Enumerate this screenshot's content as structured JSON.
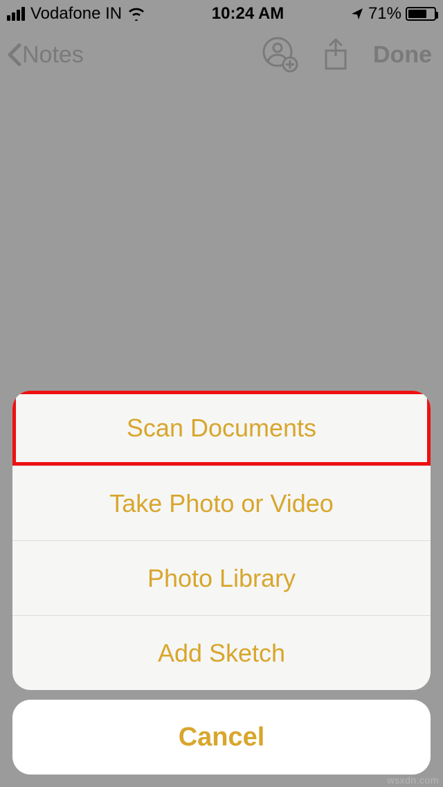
{
  "status": {
    "carrier": "Vodafone IN",
    "time": "10:24 AM",
    "battery_pct": "71%",
    "battery_fill_pct": 71
  },
  "nav": {
    "back_label": "Notes",
    "done_label": "Done"
  },
  "sheet": {
    "items": [
      {
        "label": "Scan Documents",
        "highlighted": true
      },
      {
        "label": "Take Photo or Video",
        "highlighted": false
      },
      {
        "label": "Photo Library",
        "highlighted": false
      },
      {
        "label": "Add Sketch",
        "highlighted": false
      }
    ],
    "cancel": "Cancel"
  },
  "watermark": "wsxdn.com"
}
